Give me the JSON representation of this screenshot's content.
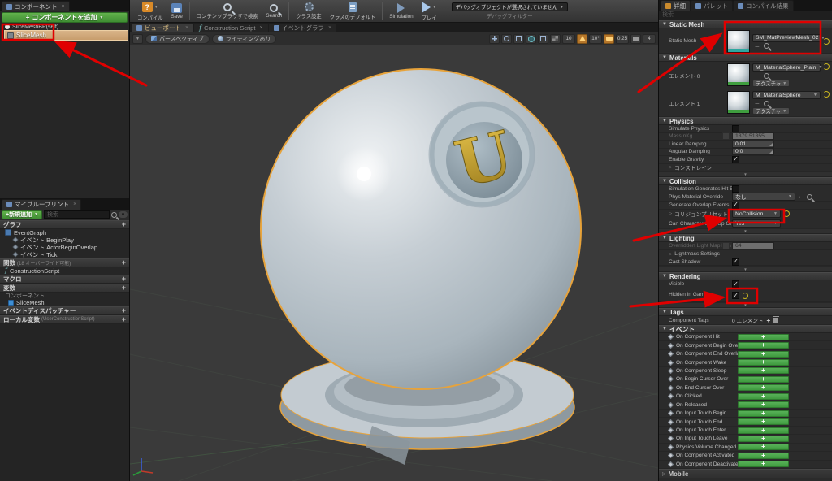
{
  "symbols": {
    "plus": "+",
    "caret_down": "▼",
    "close": "×",
    "check": "✓",
    "expand_down": "▼",
    "expand_right": "▷",
    "arrow_left": "←"
  },
  "icons": {
    "compile_badge": "?",
    "function_glyph": "f"
  },
  "left": {
    "components": {
      "tab": "コンポーネント",
      "add_button": "コンポーネントを追加",
      "root": "SliceMeshBP(self)",
      "child": "SliceMesh"
    },
    "my_blueprint": {
      "tab": "マイブループリント",
      "add_new": "+新規追加",
      "search_placeholder": "検索",
      "graphs": {
        "label": "グラフ",
        "event_graph": "EventGraph",
        "events": [
          "イベント BeginPlay",
          "イベント ActorBeginOverlap",
          "イベント Tick"
        ]
      },
      "functions": {
        "label": "関数",
        "note": "(18 オーバーライド可能)",
        "construction_script": "ConstructionScript"
      },
      "macros": {
        "label": "マクロ"
      },
      "variables": {
        "label": "変数",
        "group": "コンポーネント",
        "item": "SliceMesh"
      },
      "dispatchers": {
        "label": "イベントディスパッチャー"
      },
      "locals": {
        "label": "ローカル変数",
        "note": "(UserConstructionScript)"
      }
    }
  },
  "toolbar": {
    "buttons": [
      "コンパイル",
      "Save",
      "コンテンツブラウザで検索",
      "Search",
      "クラス設定",
      "クラスのデフォルト",
      "Simulation",
      "プレイ"
    ],
    "debug_object": "デバッグオブジェクトが選択されていません",
    "debug_filter": "デバッグフィルター"
  },
  "doc_tabs": [
    "ビューポート",
    "Construction Script",
    "イベントグラフ"
  ],
  "viewport": {
    "perspective": "パースペクティブ",
    "lit": "ライティングあり",
    "grid_snap": "10",
    "angle_snap": "10°",
    "scale_snap": "0.25",
    "camera_speed": "4"
  },
  "details": {
    "tabs": [
      "詳細",
      "パレット",
      "コンパイル結果"
    ],
    "search_placeholder": "検索",
    "static_mesh": {
      "section": "Static Mesh",
      "label": "Static Mesh",
      "value": "SM_MatPreviewMesh_02"
    },
    "materials": {
      "section": "Materials",
      "texture_button": "テクスチャ",
      "elements": [
        {
          "label": "エレメント 0",
          "value": "M_MaterialSphere_Plain"
        },
        {
          "label": "エレメント 1",
          "value": "M_MaterialSphere"
        }
      ]
    },
    "physics": {
      "section": "Physics",
      "simulate": "Simulate Physics",
      "mass_label": "MassInKg",
      "mass_value": "1379.51355",
      "linear": "Linear Damping",
      "linear_value": "0.01",
      "angular": "Angular Damping",
      "angular_value": "0.0",
      "gravity": "Enable Gravity",
      "constraints": "コンストレイン"
    },
    "collision": {
      "section": "Collision",
      "hit_events": "Simulation Generates Hit Events",
      "phys_override": "Phys Material Override",
      "phys_override_value": "なし",
      "overlap": "Generate Overlap Events",
      "preset": "コリジョンプリセット",
      "preset_value": "NoCollision",
      "step_up": "Can Character Step Up On",
      "step_up_value": "Yes"
    },
    "lighting": {
      "section": "Lighting",
      "lightmap": "Overridden Light Map Res",
      "lightmap_value": "64",
      "lightmass": "Lightmass Settings",
      "cast_shadow": "Cast Shadow"
    },
    "rendering": {
      "section": "Rendering",
      "visible": "Visible",
      "hidden": "Hidden in Game"
    },
    "tags": {
      "section": "Tags",
      "label": "Component Tags",
      "value": "0 エレメント"
    },
    "events": {
      "section": "イベント",
      "items": [
        "On Component Hit",
        "On Component Begin Overlap",
        "On Component End Overlap",
        "On Component Wake",
        "On Component Sleep",
        "On Begin Cursor Over",
        "On End Cursor Over",
        "On Clicked",
        "On Released",
        "On Input Touch Begin",
        "On Input Touch End",
        "On Input Touch Enter",
        "On Input Touch Leave",
        "Physics Volume Changed",
        "On Component Activated",
        "On Component Deactivated"
      ]
    },
    "mobile": {
      "section": "Mobile"
    }
  },
  "colors": {
    "accent_green": "#4fae4f",
    "selection_tan": "#d1a878",
    "annotation_red": "#e00000",
    "selection_outline_orange": "#e7a33b",
    "logo_gold": "#c9a227"
  }
}
